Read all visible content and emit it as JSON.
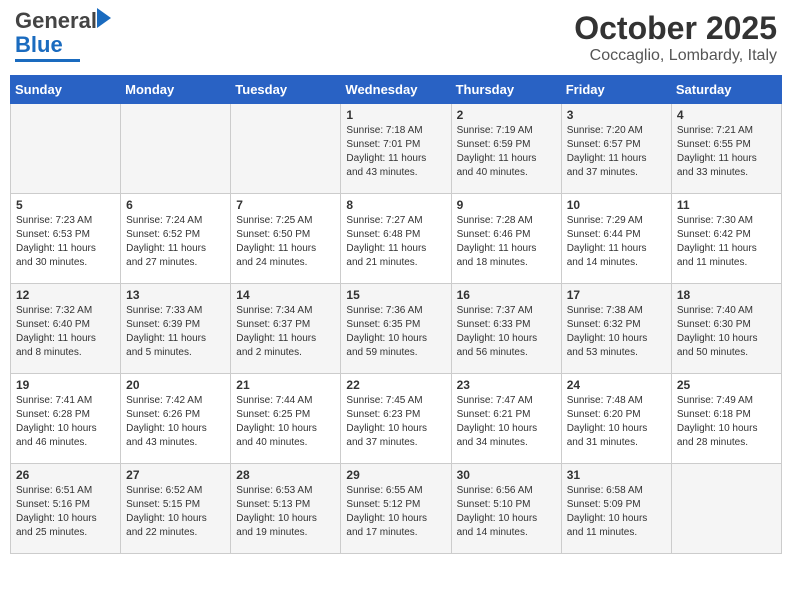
{
  "header": {
    "logo_general": "General",
    "logo_blue": "Blue",
    "month": "October 2025",
    "location": "Coccaglio, Lombardy, Italy"
  },
  "days_of_week": [
    "Sunday",
    "Monday",
    "Tuesday",
    "Wednesday",
    "Thursday",
    "Friday",
    "Saturday"
  ],
  "weeks": [
    [
      {
        "day": "",
        "content": ""
      },
      {
        "day": "",
        "content": ""
      },
      {
        "day": "",
        "content": ""
      },
      {
        "day": "1",
        "content": "Sunrise: 7:18 AM\nSunset: 7:01 PM\nDaylight: 11 hours\nand 43 minutes."
      },
      {
        "day": "2",
        "content": "Sunrise: 7:19 AM\nSunset: 6:59 PM\nDaylight: 11 hours\nand 40 minutes."
      },
      {
        "day": "3",
        "content": "Sunrise: 7:20 AM\nSunset: 6:57 PM\nDaylight: 11 hours\nand 37 minutes."
      },
      {
        "day": "4",
        "content": "Sunrise: 7:21 AM\nSunset: 6:55 PM\nDaylight: 11 hours\nand 33 minutes."
      }
    ],
    [
      {
        "day": "5",
        "content": "Sunrise: 7:23 AM\nSunset: 6:53 PM\nDaylight: 11 hours\nand 30 minutes."
      },
      {
        "day": "6",
        "content": "Sunrise: 7:24 AM\nSunset: 6:52 PM\nDaylight: 11 hours\nand 27 minutes."
      },
      {
        "day": "7",
        "content": "Sunrise: 7:25 AM\nSunset: 6:50 PM\nDaylight: 11 hours\nand 24 minutes."
      },
      {
        "day": "8",
        "content": "Sunrise: 7:27 AM\nSunset: 6:48 PM\nDaylight: 11 hours\nand 21 minutes."
      },
      {
        "day": "9",
        "content": "Sunrise: 7:28 AM\nSunset: 6:46 PM\nDaylight: 11 hours\nand 18 minutes."
      },
      {
        "day": "10",
        "content": "Sunrise: 7:29 AM\nSunset: 6:44 PM\nDaylight: 11 hours\nand 14 minutes."
      },
      {
        "day": "11",
        "content": "Sunrise: 7:30 AM\nSunset: 6:42 PM\nDaylight: 11 hours\nand 11 minutes."
      }
    ],
    [
      {
        "day": "12",
        "content": "Sunrise: 7:32 AM\nSunset: 6:40 PM\nDaylight: 11 hours\nand 8 minutes."
      },
      {
        "day": "13",
        "content": "Sunrise: 7:33 AM\nSunset: 6:39 PM\nDaylight: 11 hours\nand 5 minutes."
      },
      {
        "day": "14",
        "content": "Sunrise: 7:34 AM\nSunset: 6:37 PM\nDaylight: 11 hours\nand 2 minutes."
      },
      {
        "day": "15",
        "content": "Sunrise: 7:36 AM\nSunset: 6:35 PM\nDaylight: 10 hours\nand 59 minutes."
      },
      {
        "day": "16",
        "content": "Sunrise: 7:37 AM\nSunset: 6:33 PM\nDaylight: 10 hours\nand 56 minutes."
      },
      {
        "day": "17",
        "content": "Sunrise: 7:38 AM\nSunset: 6:32 PM\nDaylight: 10 hours\nand 53 minutes."
      },
      {
        "day": "18",
        "content": "Sunrise: 7:40 AM\nSunset: 6:30 PM\nDaylight: 10 hours\nand 50 minutes."
      }
    ],
    [
      {
        "day": "19",
        "content": "Sunrise: 7:41 AM\nSunset: 6:28 PM\nDaylight: 10 hours\nand 46 minutes."
      },
      {
        "day": "20",
        "content": "Sunrise: 7:42 AM\nSunset: 6:26 PM\nDaylight: 10 hours\nand 43 minutes."
      },
      {
        "day": "21",
        "content": "Sunrise: 7:44 AM\nSunset: 6:25 PM\nDaylight: 10 hours\nand 40 minutes."
      },
      {
        "day": "22",
        "content": "Sunrise: 7:45 AM\nSunset: 6:23 PM\nDaylight: 10 hours\nand 37 minutes."
      },
      {
        "day": "23",
        "content": "Sunrise: 7:47 AM\nSunset: 6:21 PM\nDaylight: 10 hours\nand 34 minutes."
      },
      {
        "day": "24",
        "content": "Sunrise: 7:48 AM\nSunset: 6:20 PM\nDaylight: 10 hours\nand 31 minutes."
      },
      {
        "day": "25",
        "content": "Sunrise: 7:49 AM\nSunset: 6:18 PM\nDaylight: 10 hours\nand 28 minutes."
      }
    ],
    [
      {
        "day": "26",
        "content": "Sunrise: 6:51 AM\nSunset: 5:16 PM\nDaylight: 10 hours\nand 25 minutes."
      },
      {
        "day": "27",
        "content": "Sunrise: 6:52 AM\nSunset: 5:15 PM\nDaylight: 10 hours\nand 22 minutes."
      },
      {
        "day": "28",
        "content": "Sunrise: 6:53 AM\nSunset: 5:13 PM\nDaylight: 10 hours\nand 19 minutes."
      },
      {
        "day": "29",
        "content": "Sunrise: 6:55 AM\nSunset: 5:12 PM\nDaylight: 10 hours\nand 17 minutes."
      },
      {
        "day": "30",
        "content": "Sunrise: 6:56 AM\nSunset: 5:10 PM\nDaylight: 10 hours\nand 14 minutes."
      },
      {
        "day": "31",
        "content": "Sunrise: 6:58 AM\nSunset: 5:09 PM\nDaylight: 10 hours\nand 11 minutes."
      },
      {
        "day": "",
        "content": ""
      }
    ]
  ]
}
